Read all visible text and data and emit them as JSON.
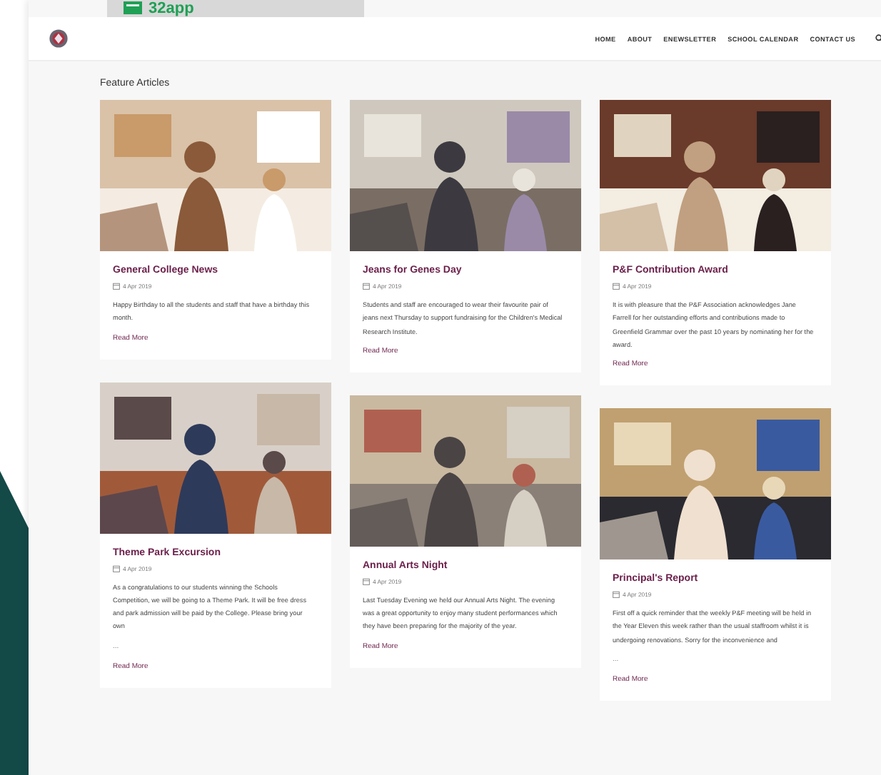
{
  "banner": {
    "logo_text": "32app"
  },
  "header": {
    "nav": [
      "HOME",
      "ABOUT",
      "ENEWSLETTER",
      "SCHOOL CALENDAR",
      "CONTACT US"
    ]
  },
  "section_title": "Feature Articles",
  "columns": [
    [
      {
        "title": "General College News",
        "date": "4 Apr 2019",
        "body": "Happy Birthday to all the students and staff that have a birthday this month.",
        "link": "Read More"
      },
      {
        "title": "Theme Park Excursion",
        "date": "4 Apr 2019",
        "body": "As a congratulations to our students winning the Schools Competition, we will be going to a Theme Park. It will be free dress and park admission will be paid by the College. Please bring your own",
        "more": "...",
        "link": "Read More"
      }
    ],
    [
      {
        "title": "Jeans for Genes Day",
        "date": "4 Apr 2019",
        "body": "Students and staff are encouraged to wear their favourite pair of jeans next Thursday to support fundraising for the Children's Medical Research Institute.",
        "link": "Read More"
      },
      {
        "title": "Annual Arts Night",
        "date": "4 Apr 2019",
        "body": "Last Tuesday Evening we held our Annual Arts Night. The evening was a great opportunity to enjoy many student performances which they have been preparing for the majority of the year.",
        "link": "Read More"
      }
    ],
    [
      {
        "title": "P&F Contribution Award",
        "date": "4 Apr 2019",
        "body": "It is with pleasure that the P&F Association acknowledges Jane Farrell for her outstanding efforts and contributions made to Greenfield Grammar over the past 10 years by nominating her for the award.",
        "link": "Read More"
      },
      {
        "title": "Principal's Report",
        "date": "4 Apr 2019",
        "body": "First off a quick reminder that the weekly P&F meeting will be held in the Year Eleven this week rather than the usual staffroom whilst it is undergoing renovations. Sorry for the inconvenience and",
        "more": "...",
        "link": "Read More"
      }
    ]
  ]
}
